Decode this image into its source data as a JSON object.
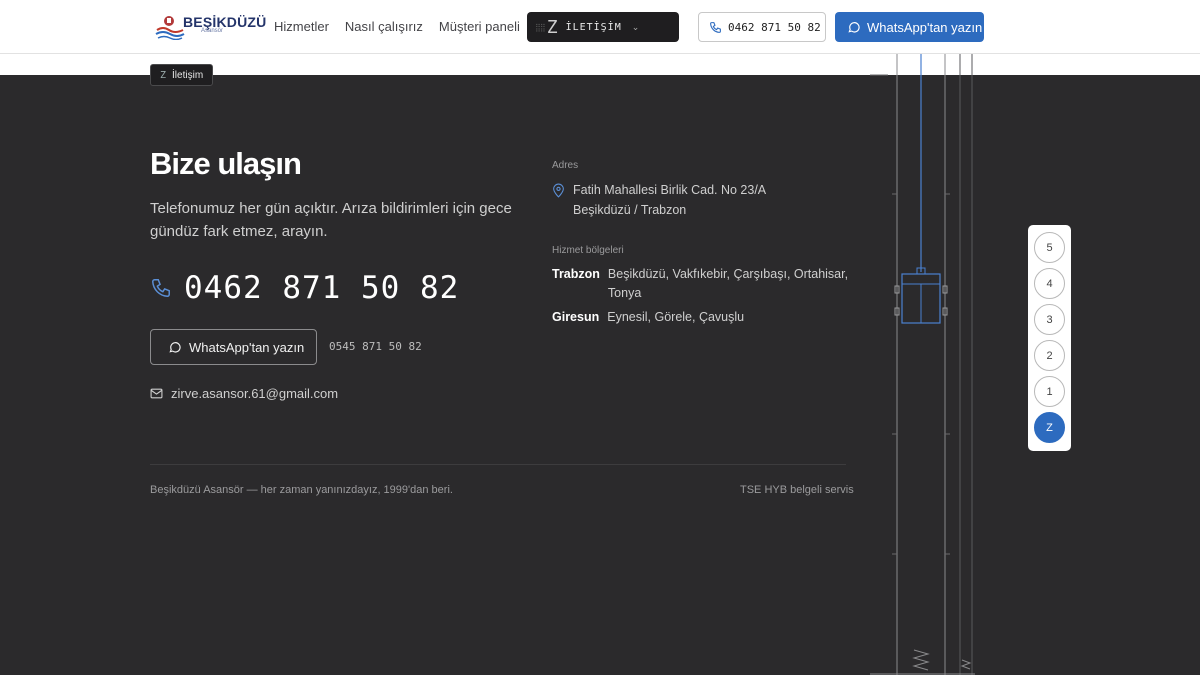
{
  "brand": {
    "name": "BEŞİKDÜZÜ",
    "sub": "Asansör"
  },
  "nav": {
    "items": [
      "Hizmetler",
      "Nasıl çalışırız",
      "Müşteri paneli"
    ]
  },
  "floor_pill": {
    "floor": "Z",
    "label": "İLETİŞİM"
  },
  "header": {
    "phone": "0462 871 50 82",
    "whatsapp": "WhatsApp'tan yazın"
  },
  "floor_tag": {
    "floor": "Z",
    "label": "İletişim"
  },
  "main": {
    "title": "Bize ulaşın",
    "lead": "Telefonumuz her gün açıktır. Arıza bildirimleri için gece gündüz fark etmez, arayın.",
    "phone": "0462 871 50 82",
    "whatsapp": "WhatsApp'tan yazın",
    "alt_phone": "0545 871 50 82",
    "email": "zirve.asansor.61@gmail.com"
  },
  "address": {
    "label": "Adres",
    "line1": "Fatih Mahallesi Birlik Cad. No 23/A",
    "line2": "Beşikdüzü / Trabzon"
  },
  "regions": {
    "label": "Hizmet bölgeleri",
    "items": [
      {
        "city": "Trabzon",
        "areas": "Beşikdüzü, Vakfıkebir, Çarşıbaşı, Ortahisar, Tonya"
      },
      {
        "city": "Giresun",
        "areas": "Eynesil, Görele, Çavuşlu"
      }
    ]
  },
  "footer": {
    "left": "Beşikdüzü Asansör — her zaman yanınızdayız, 1999'dan beri.",
    "right": "TSE HYB belgeli servis"
  },
  "floors": [
    "5",
    "4",
    "3",
    "2",
    "1",
    "Z"
  ],
  "active_floor": "Z",
  "colors": {
    "accent": "#2d6bbf",
    "background": "#2b2a2c",
    "header": "#ffffff"
  }
}
